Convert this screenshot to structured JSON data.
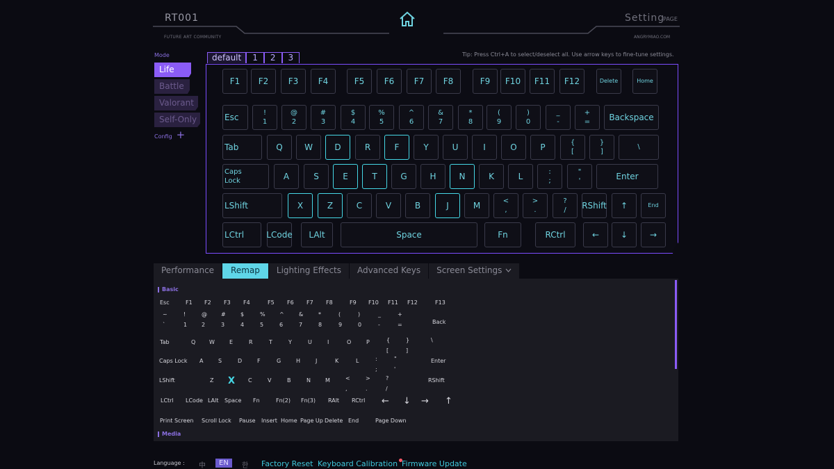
{
  "header": {
    "logo": "RT001",
    "community": "FUTURE ART COMMUNITY",
    "site": "ANGRYMIAO.COM",
    "title": "Setting",
    "page_label": "PAGE",
    "home_icon": "home-icon"
  },
  "modes": {
    "label": "Mode",
    "items": [
      {
        "label": "Life",
        "active": true
      },
      {
        "label": "Battle",
        "active": false
      },
      {
        "label": "Valorant",
        "active": false
      },
      {
        "label": "Self-Only",
        "active": false
      }
    ],
    "config_label": "Config",
    "config_plus": "+"
  },
  "profile_tabs": [
    "default",
    "1",
    "2",
    "3"
  ],
  "tip": "Tip: Press Ctrl+A to select/deselect all. Use arrow keys to fine-tune settings.",
  "keyboard": {
    "rows": [
      [
        "F1",
        "F2",
        "F3",
        "F4",
        "F5",
        "F6",
        "F7",
        "F8",
        "F9",
        "F10",
        "F11",
        "F12",
        "Delete",
        "Home"
      ],
      [
        "Esc",
        "!|1",
        "@|2",
        "#|3",
        "$|4",
        "%|5",
        "^|6",
        "&|7",
        "*|8",
        "(|9",
        ")|0",
        "_|-",
        "+|=",
        "Backspace"
      ],
      [
        "Tab",
        "Q",
        "W",
        "D",
        "R",
        "F",
        "Y",
        "U",
        "I",
        "O",
        "P",
        "{|[",
        "}|]",
        "\\||"
      ],
      [
        "Caps|Lock",
        "A",
        "S",
        "E",
        "T",
        "G",
        "H",
        "N",
        "K",
        "L",
        ":|;",
        "\"|'",
        "Enter"
      ],
      [
        "LShift",
        "X",
        "Z",
        "C",
        "V",
        "B",
        "J",
        "M",
        "<|,",
        ">|.",
        "?|/",
        "RShift",
        "↑",
        "End"
      ],
      [
        "LCtrl",
        "LCode",
        "LAlt",
        "Space",
        "Fn",
        "RCtrl",
        "←",
        "↓",
        "→"
      ]
    ]
  },
  "bottom_tabs": [
    "Performance",
    "Remap",
    "Lighting Effects",
    "Advanced Keys",
    "Screen Settings"
  ],
  "dropdown_icon": "chevron-down-icon",
  "remap": {
    "basic_label": "Basic",
    "media_label": "Media",
    "rows": [
      [
        "Esc",
        "F1",
        "F2",
        "F3",
        "F4",
        "F5",
        "F6",
        "F7",
        "F8",
        "F9",
        "F10",
        "F11",
        "F12",
        "F13"
      ],
      [
        "~|`",
        "!|1",
        "@|2",
        "#|3",
        "$|4",
        "%|5",
        "^|6",
        "&|7",
        "*|8",
        "(|9",
        ")|0",
        "_|-",
        "+|=",
        "Back"
      ],
      [
        "Tab",
        "Q",
        "W",
        "E",
        "R",
        "T",
        "Y",
        "U",
        "I",
        "O",
        "P",
        "{|[",
        "}|]",
        "\\||"
      ],
      [
        "Caps Lock",
        "A",
        "S",
        "D",
        "F",
        "G",
        "H",
        "J",
        "K",
        "L",
        ":|;",
        "\"|'",
        "Enter"
      ],
      [
        "LShift",
        "Z",
        "X",
        "C",
        "V",
        "B",
        "N",
        "M",
        "<|,",
        ">|.",
        "?|/",
        "RShift"
      ],
      [
        "LCtrl",
        "LCode",
        "LAlt",
        "Space",
        "Fn",
        "Fn(2)",
        "Fn(3)",
        "RAlt",
        "RCtrl",
        "←",
        "↓",
        "→",
        "↑"
      ],
      [
        "Print Screen",
        "Scroll Lock",
        "Pause",
        "Insert",
        "Home",
        "Page Up",
        "Delete",
        "End",
        "Page Down"
      ]
    ]
  },
  "footer": {
    "language_label": "Language :",
    "languages": [
      {
        "label": "中",
        "active": false
      },
      {
        "label": "EN",
        "active": true
      },
      {
        "label": "한",
        "active": false
      }
    ],
    "links": [
      "Factory Reset",
      "Keyboard Calibration",
      "Firmware Update"
    ]
  },
  "colors": {
    "accent_purple": "#8b5cf6",
    "accent_cyan": "#46d8e6",
    "background": "#0b0b12",
    "notification_dot": "#ff5a6a"
  }
}
